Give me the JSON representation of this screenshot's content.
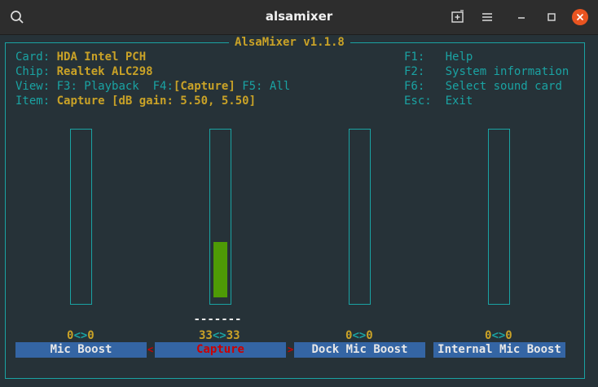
{
  "window": {
    "title": "alsamixer"
  },
  "header": {
    "app_title": "AlsaMixer v1.1.8",
    "card_label": "Card:",
    "card_value": "HDA Intel PCH",
    "chip_label": "Chip:",
    "chip_value": "Realtek ALC298",
    "view_label": "View:",
    "view_f3": "F3: Playback",
    "view_f4_key": "F4:",
    "view_f4_value": "[Capture]",
    "view_f5": "F5: All",
    "item_label": "Item:",
    "item_value": "Capture [dB gain: 5.50, 5.50]"
  },
  "help": [
    {
      "key": "F1:",
      "text": "Help"
    },
    {
      "key": "F2:",
      "text": "System information"
    },
    {
      "key": "F6:",
      "text": "Select sound card"
    },
    {
      "key": "Esc:",
      "text": "Exit"
    }
  ],
  "controls": [
    {
      "name": "Mic Boost",
      "left": "0",
      "sep": "<>",
      "right": "0",
      "level": 0
    },
    {
      "name": "Capture",
      "left": "33",
      "sep": "<>",
      "right": "33",
      "level": 0.33,
      "selected": true,
      "marker": "-------"
    },
    {
      "name": "Dock Mic Boost",
      "left": "0",
      "sep": "<>",
      "right": "0",
      "level": 0
    },
    {
      "name": "Internal Mic Boost",
      "left": "0",
      "sep": "<>",
      "right": "0",
      "level": 0
    }
  ],
  "selection_arrows": {
    "left": "<",
    "right": ">"
  },
  "colors": {
    "frame": "#1aa3a3",
    "value": "#c9a227",
    "label_bg": "#3465a4",
    "selected_text": "#cc0000",
    "bar_fill": "#4e9a06",
    "close_button": "#e95420"
  },
  "icons": {
    "search": "search-icon",
    "new_tab": "new-tab-icon",
    "menu": "hamburger-menu-icon",
    "minimize": "minimize-icon",
    "maximize": "maximize-icon",
    "close": "close-icon"
  }
}
